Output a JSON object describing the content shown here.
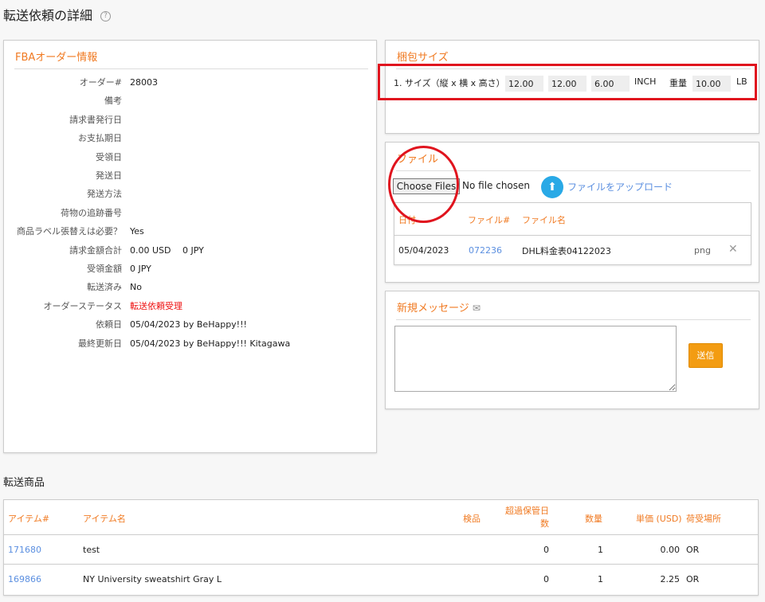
{
  "page": {
    "title": "転送依頼の詳細",
    "help_icon": "question-circle-icon"
  },
  "order_info": {
    "header": "FBAオーダー情報",
    "rows": [
      {
        "label": "オーダー#",
        "value": "28003"
      },
      {
        "label": "備考",
        "value": ""
      },
      {
        "label": "請求書発行日",
        "value": ""
      },
      {
        "label": "お支払期日",
        "value": ""
      },
      {
        "label": "受領日",
        "value": ""
      },
      {
        "label": "発送日",
        "value": ""
      },
      {
        "label": "発送方法",
        "value": ""
      },
      {
        "label": "荷物の追跡番号",
        "value": ""
      },
      {
        "label": "商品ラベル張替えは必要？",
        "value": "Yes"
      },
      {
        "label": "請求金額合計",
        "value": "0.00 USD　 0 JPY"
      },
      {
        "label": "受領金額",
        "value": "0 JPY"
      },
      {
        "label": "転送済み",
        "value": "No"
      },
      {
        "label": "オーダーステータス",
        "value": "転送依頼受理"
      },
      {
        "label": "依頼日",
        "value": "05/04/2023 by BeHappy!!!"
      },
      {
        "label": "最終更新日",
        "value": "05/04/2023 by BeHappy!!! Kitagawa"
      }
    ],
    "status_color": "#ee1111"
  },
  "package": {
    "header": "梱包サイズ",
    "size_label": "1. サイズ（縦 x 横 x 高さ）",
    "length": "12.00",
    "width": "12.00",
    "height": "6.00",
    "size_unit": "INCH",
    "weight_label": "重量",
    "weight": "10.00",
    "weight_unit": "LB"
  },
  "files": {
    "header": "ファイル",
    "choose_button": "Choose Files",
    "no_file": "No file chosen",
    "upload_label": "ファイルをアップロード",
    "columns": [
      "日付",
      "ファイル#",
      "ファイル名"
    ],
    "rows": [
      {
        "date": "05/04/2023",
        "file_no": "072236",
        "name": "DHL料金表04122023",
        "type": "png"
      }
    ]
  },
  "message": {
    "header": "新規メッセージ",
    "send_button": "送信",
    "textarea_value": ""
  },
  "products": {
    "title": "転送商品",
    "columns": [
      "アイテム#",
      "アイテム名",
      "検品",
      "超過保管日数",
      "数量",
      "単価 (USD)",
      "荷受場所"
    ],
    "rows": [
      {
        "item_no": "171680",
        "name": "test",
        "inspection": "",
        "overdue_days": "0",
        "qty": "1",
        "price": "0.00",
        "location": "OR"
      },
      {
        "item_no": "169866",
        "name": "NY University sweatshirt Gray L",
        "inspection": "",
        "overdue_days": "0",
        "qty": "1",
        "price": "2.25",
        "location": "OR"
      }
    ]
  },
  "colors": {
    "accent": "#f07a22",
    "link": "#5b8fe0",
    "annotation": "#e0141e",
    "send": "#f39c12"
  }
}
